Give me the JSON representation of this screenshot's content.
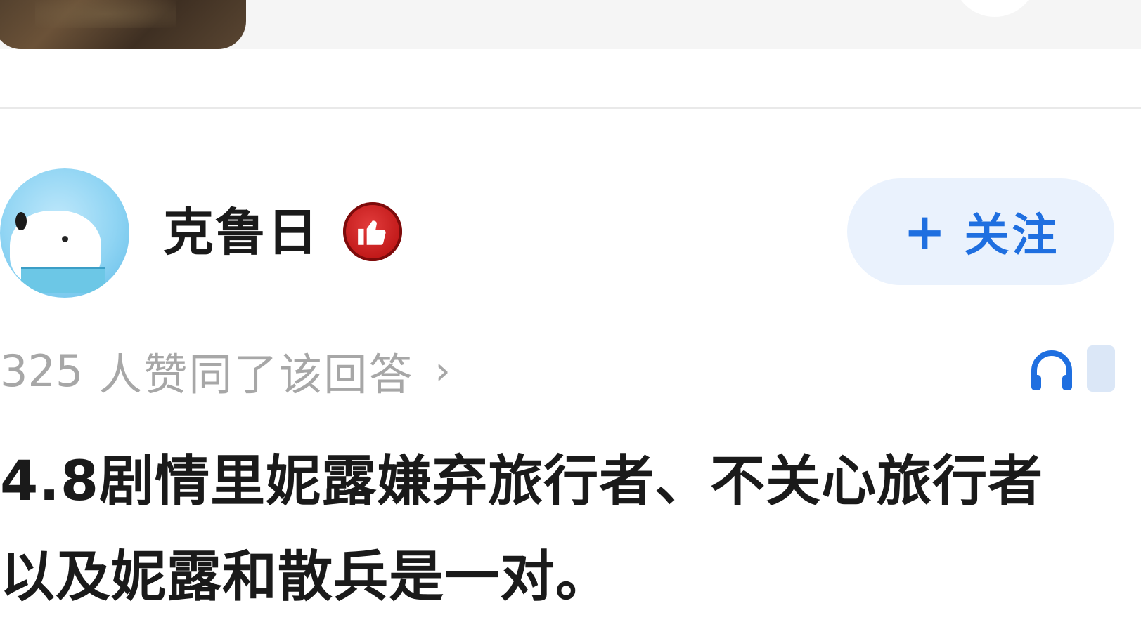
{
  "author": {
    "name": "克鲁日",
    "follow_plus": "+",
    "follow_label": "关注"
  },
  "likes": {
    "count": "325",
    "text": "人赞同了该回答",
    "chevron": "›"
  },
  "answer": {
    "line1": "4.8剧情里妮露嫌弃旅行者、不关心旅行者",
    "line2": "以及妮露和散兵是一对。"
  },
  "colors": {
    "accent": "#1f6fe0",
    "follow_bg": "#eaf2fd",
    "muted_text": "#a7a7a7",
    "badge_red": "#c01818"
  },
  "icons": {
    "badge": "thumbs-up-icon",
    "listen": "headphone-icon"
  }
}
